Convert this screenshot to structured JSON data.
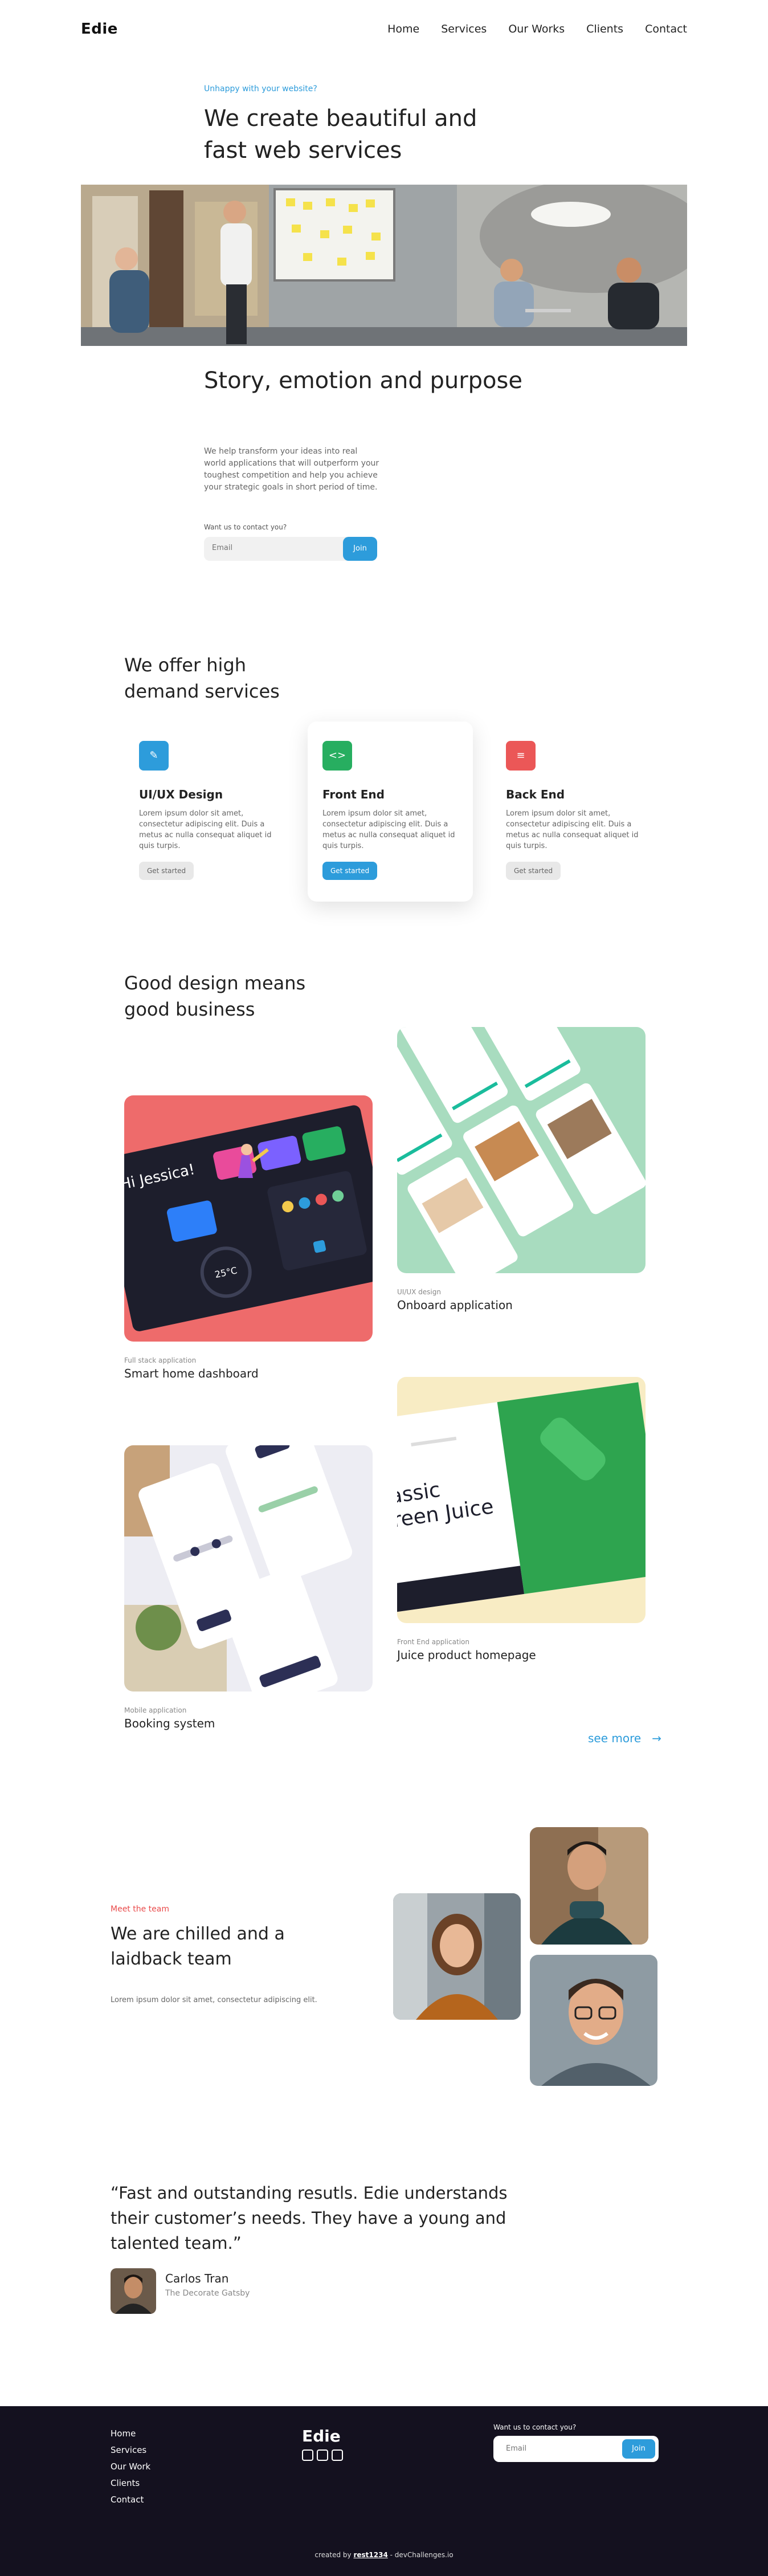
{
  "nav": {
    "logo": "Edie",
    "items": [
      "Home",
      "Services",
      "Our Works",
      "Clients",
      "Contact"
    ]
  },
  "hero": {
    "eyebrow": "Unhappy with your website?",
    "title": "We create beautiful and fast web services",
    "story_title": "Story, emotion and purpose",
    "story_text": "We help transform your ideas into real world applications that will outperform your toughest competition and help you achieve your strategic goals in short period of time.",
    "contact_label": "Want us to contact you?",
    "email_placeholder": "Email",
    "join_label": "Join"
  },
  "services": {
    "title": "We offer high demand services",
    "items": [
      {
        "title": "UI/UX Design",
        "text": "Lorem ipsum dolor sit amet, consectetur adipiscing elit. Duis a metus ac nulla consequat aliquet id quis turpis.",
        "button": "Get started",
        "icon": "pencil-icon",
        "color": "#2d9cdb"
      },
      {
        "title": "Front End",
        "text": "Lorem ipsum dolor sit amet, consectetur adipiscing elit. Duis a metus ac nulla consequat aliquet id quis turpis.",
        "button": "Get started",
        "icon": "code-icon",
        "color": "#27ae60"
      },
      {
        "title": "Back End",
        "text": "Lorem ipsum dolor sit amet, consectetur adipiscing elit. Duis a metus ac nulla consequat aliquet id quis turpis.",
        "button": "Get started",
        "icon": "server-icon",
        "color": "#eb5757"
      }
    ]
  },
  "works": {
    "title": "Good design means good business",
    "items": [
      {
        "category": "UI/UX design",
        "name": "Onboard application"
      },
      {
        "category": "Full stack application",
        "name": "Smart home dashboard"
      },
      {
        "category": "Front End application",
        "name": "Juice product homepage"
      },
      {
        "category": "Mobile application",
        "name": "Booking system"
      }
    ],
    "see_more": "see more",
    "mockup": {
      "dash_greeting": "Hi Jessica!",
      "dash_temp": "25°C",
      "juice_line1": "assic",
      "juice_line2": "reen Juice"
    }
  },
  "team": {
    "eyebrow": "Meet the team",
    "title": "We are chilled and a laidback team",
    "text": "Lorem ipsum dolor sit amet, consectetur adipiscing elit."
  },
  "testimonial": {
    "quote": "“Fast and outstanding resutls. Edie understands their customer’s needs. They have a young and talented team.”",
    "name": "Carlos Tran",
    "role": "The Decorate Gatsby"
  },
  "footer": {
    "links": [
      "Home",
      "Services",
      "Our Work",
      "Clients",
      "Contact"
    ],
    "logo": "Edie",
    "contact_label": "Want us to contact you?",
    "email_placeholder": "Email",
    "join_label": "Join",
    "credit_prefix": "created by",
    "credit_user": "rest1234",
    "credit_suffix": "- devChallenges.io"
  }
}
